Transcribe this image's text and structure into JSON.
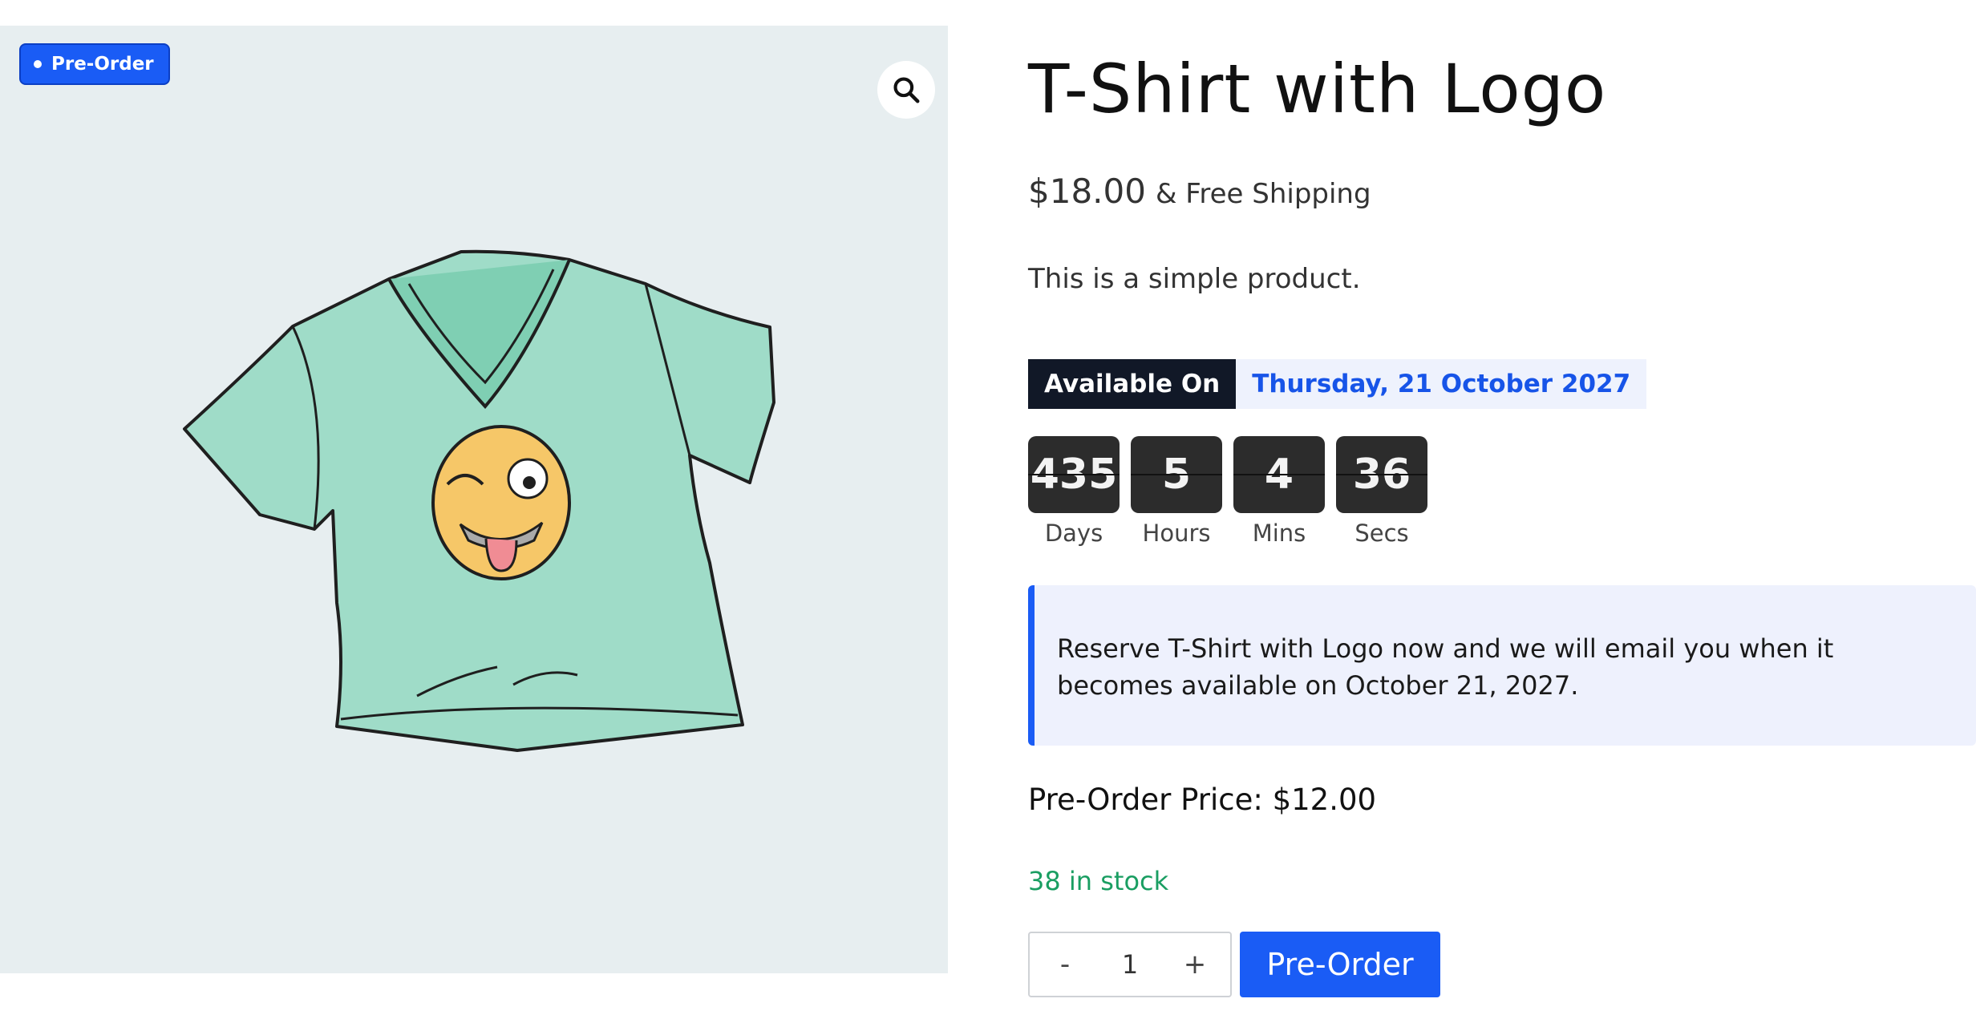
{
  "product": {
    "badge": "Pre-Order",
    "title": "T-Shirt with Logo",
    "price": "$18.00",
    "shipping": "& Free Shipping",
    "description": "This is a simple product."
  },
  "availability": {
    "label": "Available On",
    "date": "Thursday, 21 October 2027"
  },
  "countdown": [
    {
      "value": "435",
      "label": "Days"
    },
    {
      "value": "5",
      "label": "Hours"
    },
    {
      "value": "4",
      "label": "Mins"
    },
    {
      "value": "36",
      "label": "Secs"
    }
  ],
  "notice": "Reserve T-Shirt with Logo now and we will email you when it becomes available on October 21, 2027.",
  "preorder_price": "Pre-Order Price: $12.00",
  "stock": "38 in stock",
  "cart": {
    "minus": "-",
    "quantity": "1",
    "plus": "+",
    "button": "Pre-Order"
  },
  "colors": {
    "accent": "#1a5cf5",
    "stock_green": "#1a9e62",
    "dark": "#111827"
  },
  "icons": {
    "zoom": "search-icon"
  }
}
